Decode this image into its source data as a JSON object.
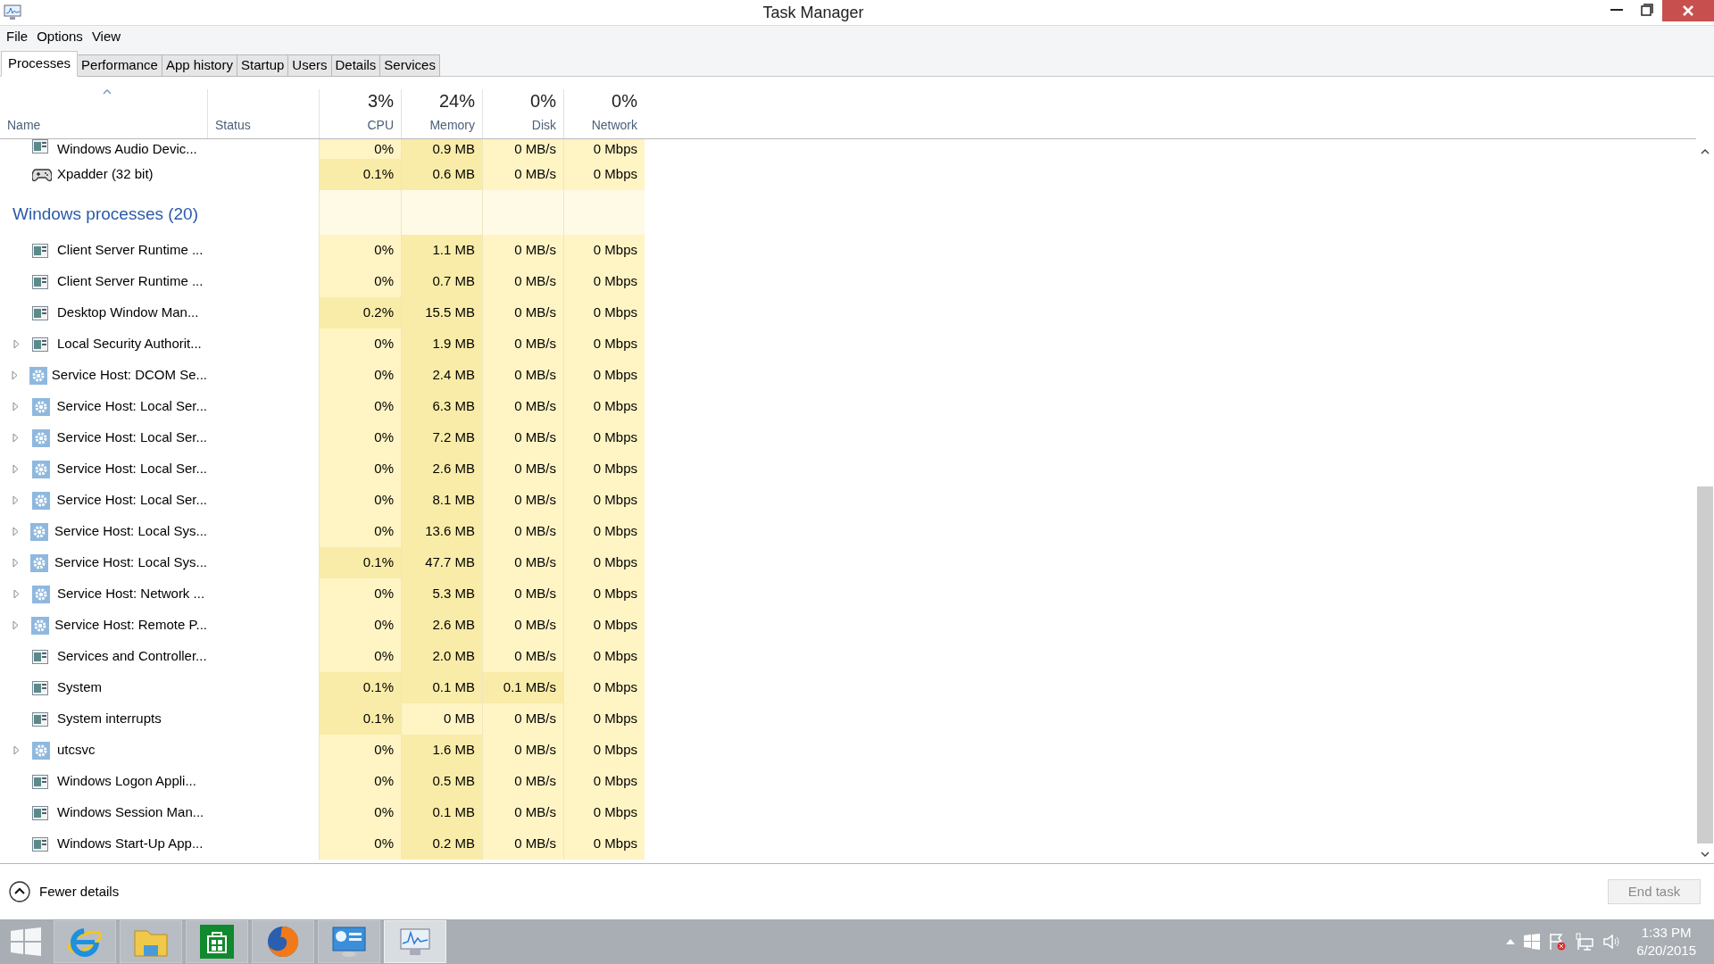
{
  "window": {
    "title": "Task Manager"
  },
  "menu": [
    "File",
    "Options",
    "View"
  ],
  "tabs": [
    {
      "label": "Processes",
      "selected": true
    },
    {
      "label": "Performance",
      "selected": false
    },
    {
      "label": "App history",
      "selected": false
    },
    {
      "label": "Startup",
      "selected": false
    },
    {
      "label": "Users",
      "selected": false
    },
    {
      "label": "Details",
      "selected": false
    },
    {
      "label": "Services",
      "selected": false
    }
  ],
  "table": {
    "columns": [
      {
        "label": "Name",
        "sorted": true
      },
      {
        "label": "Status",
        "sorted": false
      },
      {
        "label": "CPU",
        "total": "3%",
        "sorted": false
      },
      {
        "label": "Memory",
        "total": "24%",
        "sorted": false
      },
      {
        "label": "Disk",
        "total": "0%",
        "sorted": false
      },
      {
        "label": "Network",
        "total": "0%",
        "sorted": false
      }
    ],
    "rows": [
      {
        "kind": "app",
        "expandable": false,
        "name": "Windows Audio Devic...",
        "cells": [
          {
            "text": "0%",
            "color": "#fff4c4"
          },
          {
            "text": "0.9 MB",
            "color": "#f9eca8"
          },
          {
            "text": "0 MB/s",
            "color": "#fff4c4"
          },
          {
            "text": "0 Mbps",
            "color": "#fff4c4"
          }
        ]
      },
      {
        "kind": "game",
        "expandable": false,
        "name": "Xpadder (32 bit)",
        "cells": [
          {
            "text": "0.1%",
            "color": "#f9eca8"
          },
          {
            "text": "0.6 MB",
            "color": "#f9eca8"
          },
          {
            "text": "0 MB/s",
            "color": "#fff4c4"
          },
          {
            "text": "0 Mbps",
            "color": "#fff4c4"
          }
        ]
      },
      {
        "kind": "group",
        "name": "Windows processes (20)"
      },
      {
        "kind": "app",
        "expandable": false,
        "name": "Client Server Runtime ...",
        "cells": [
          {
            "text": "0%",
            "color": "#fff4c4"
          },
          {
            "text": "1.1 MB",
            "color": "#f9eca8"
          },
          {
            "text": "0 MB/s",
            "color": "#fff4c4"
          },
          {
            "text": "0 Mbps",
            "color": "#fff4c4"
          }
        ]
      },
      {
        "kind": "app",
        "expandable": false,
        "name": "Client Server Runtime ...",
        "cells": [
          {
            "text": "0%",
            "color": "#fff4c4"
          },
          {
            "text": "0.7 MB",
            "color": "#f9eca8"
          },
          {
            "text": "0 MB/s",
            "color": "#fff4c4"
          },
          {
            "text": "0 Mbps",
            "color": "#fff4c4"
          }
        ]
      },
      {
        "kind": "app",
        "expandable": false,
        "name": "Desktop Window Man...",
        "cells": [
          {
            "text": "0.2%",
            "color": "#f9eca8"
          },
          {
            "text": "15.5 MB",
            "color": "#f9eca8"
          },
          {
            "text": "0 MB/s",
            "color": "#fff4c4"
          },
          {
            "text": "0 Mbps",
            "color": "#fff4c4"
          }
        ]
      },
      {
        "kind": "app",
        "expandable": true,
        "name": "Local Security Authorit...",
        "cells": [
          {
            "text": "0%",
            "color": "#fff4c4"
          },
          {
            "text": "1.9 MB",
            "color": "#f9eca8"
          },
          {
            "text": "0 MB/s",
            "color": "#fff4c4"
          },
          {
            "text": "0 Mbps",
            "color": "#fff4c4"
          }
        ]
      },
      {
        "kind": "service",
        "expandable": true,
        "name": "Service Host: DCOM Se...",
        "cells": [
          {
            "text": "0%",
            "color": "#fff4c4"
          },
          {
            "text": "2.4 MB",
            "color": "#f9eca8"
          },
          {
            "text": "0 MB/s",
            "color": "#fff4c4"
          },
          {
            "text": "0 Mbps",
            "color": "#fff4c4"
          }
        ]
      },
      {
        "kind": "service",
        "expandable": true,
        "name": "Service Host: Local Ser...",
        "cells": [
          {
            "text": "0%",
            "color": "#fff4c4"
          },
          {
            "text": "6.3 MB",
            "color": "#f9eca8"
          },
          {
            "text": "0 MB/s",
            "color": "#fff4c4"
          },
          {
            "text": "0 Mbps",
            "color": "#fff4c4"
          }
        ]
      },
      {
        "kind": "service",
        "expandable": true,
        "name": "Service Host: Local Ser...",
        "cells": [
          {
            "text": "0%",
            "color": "#fff4c4"
          },
          {
            "text": "7.2 MB",
            "color": "#f9eca8"
          },
          {
            "text": "0 MB/s",
            "color": "#fff4c4"
          },
          {
            "text": "0 Mbps",
            "color": "#fff4c4"
          }
        ]
      },
      {
        "kind": "service",
        "expandable": true,
        "name": "Service Host: Local Ser...",
        "cells": [
          {
            "text": "0%",
            "color": "#fff4c4"
          },
          {
            "text": "2.6 MB",
            "color": "#f9eca8"
          },
          {
            "text": "0 MB/s",
            "color": "#fff4c4"
          },
          {
            "text": "0 Mbps",
            "color": "#fff4c4"
          }
        ]
      },
      {
        "kind": "service",
        "expandable": true,
        "name": "Service Host: Local Ser...",
        "cells": [
          {
            "text": "0%",
            "color": "#fff4c4"
          },
          {
            "text": "8.1 MB",
            "color": "#f9eca8"
          },
          {
            "text": "0 MB/s",
            "color": "#fff4c4"
          },
          {
            "text": "0 Mbps",
            "color": "#fff4c4"
          }
        ]
      },
      {
        "kind": "service",
        "expandable": true,
        "name": "Service Host: Local Sys...",
        "cells": [
          {
            "text": "0%",
            "color": "#fff4c4"
          },
          {
            "text": "13.6 MB",
            "color": "#f9eca8"
          },
          {
            "text": "0 MB/s",
            "color": "#fff4c4"
          },
          {
            "text": "0 Mbps",
            "color": "#fff4c4"
          }
        ]
      },
      {
        "kind": "service",
        "expandable": true,
        "name": "Service Host: Local Sys...",
        "cells": [
          {
            "text": "0.1%",
            "color": "#f9eca8"
          },
          {
            "text": "47.7 MB",
            "color": "#f9eca8"
          },
          {
            "text": "0 MB/s",
            "color": "#fff4c4"
          },
          {
            "text": "0 Mbps",
            "color": "#fff4c4"
          }
        ]
      },
      {
        "kind": "service",
        "expandable": true,
        "name": "Service Host: Network ...",
        "cells": [
          {
            "text": "0%",
            "color": "#fff4c4"
          },
          {
            "text": "5.3 MB",
            "color": "#f9eca8"
          },
          {
            "text": "0 MB/s",
            "color": "#fff4c4"
          },
          {
            "text": "0 Mbps",
            "color": "#fff4c4"
          }
        ]
      },
      {
        "kind": "service",
        "expandable": true,
        "name": "Service Host: Remote P...",
        "cells": [
          {
            "text": "0%",
            "color": "#fff4c4"
          },
          {
            "text": "2.6 MB",
            "color": "#f9eca8"
          },
          {
            "text": "0 MB/s",
            "color": "#fff4c4"
          },
          {
            "text": "0 Mbps",
            "color": "#fff4c4"
          }
        ]
      },
      {
        "kind": "app",
        "expandable": false,
        "name": "Services and Controller...",
        "cells": [
          {
            "text": "0%",
            "color": "#fff4c4"
          },
          {
            "text": "2.0 MB",
            "color": "#f9eca8"
          },
          {
            "text": "0 MB/s",
            "color": "#fff4c4"
          },
          {
            "text": "0 Mbps",
            "color": "#fff4c4"
          }
        ]
      },
      {
        "kind": "app",
        "expandable": false,
        "name": "System",
        "cells": [
          {
            "text": "0.1%",
            "color": "#f9eca8"
          },
          {
            "text": "0.1 MB",
            "color": "#f9eca8"
          },
          {
            "text": "0.1 MB/s",
            "color": "#f9eca8"
          },
          {
            "text": "0 Mbps",
            "color": "#fff4c4"
          }
        ]
      },
      {
        "kind": "app",
        "expandable": false,
        "name": "System interrupts",
        "cells": [
          {
            "text": "0.1%",
            "color": "#f9eca8"
          },
          {
            "text": "0 MB",
            "color": "#fff4c4"
          },
          {
            "text": "0 MB/s",
            "color": "#fff4c4"
          },
          {
            "text": "0 Mbps",
            "color": "#fff4c4"
          }
        ]
      },
      {
        "kind": "service",
        "expandable": true,
        "name": "utcsvc",
        "cells": [
          {
            "text": "0%",
            "color": "#fff4c4"
          },
          {
            "text": "1.6 MB",
            "color": "#f9eca8"
          },
          {
            "text": "0 MB/s",
            "color": "#fff4c4"
          },
          {
            "text": "0 Mbps",
            "color": "#fff4c4"
          }
        ]
      },
      {
        "kind": "app",
        "expandable": false,
        "name": "Windows Logon Appli...",
        "cells": [
          {
            "text": "0%",
            "color": "#fff4c4"
          },
          {
            "text": "0.5 MB",
            "color": "#f9eca8"
          },
          {
            "text": "0 MB/s",
            "color": "#fff4c4"
          },
          {
            "text": "0 Mbps",
            "color": "#fff4c4"
          }
        ]
      },
      {
        "kind": "app",
        "expandable": false,
        "name": "Windows Session Man...",
        "cells": [
          {
            "text": "0%",
            "color": "#fff4c4"
          },
          {
            "text": "0.1 MB",
            "color": "#f9eca8"
          },
          {
            "text": "0 MB/s",
            "color": "#fff4c4"
          },
          {
            "text": "0 Mbps",
            "color": "#fff4c4"
          }
        ]
      },
      {
        "kind": "app",
        "expandable": false,
        "name": "Windows Start-Up App...",
        "cells": [
          {
            "text": "0%",
            "color": "#fff4c4"
          },
          {
            "text": "0.2 MB",
            "color": "#f9eca8"
          },
          {
            "text": "0 MB/s",
            "color": "#fff4c4"
          },
          {
            "text": "0 Mbps",
            "color": "#fff4c4"
          }
        ]
      }
    ]
  },
  "footer": {
    "details_link": "Fewer details",
    "end_task": {
      "label": "End task",
      "disabled": true
    }
  },
  "taskbar": {
    "apps": [
      {
        "kind": "ie",
        "active": false
      },
      {
        "kind": "folder",
        "active": false
      },
      {
        "kind": "store",
        "active": false
      },
      {
        "kind": "firefox",
        "active": false
      },
      {
        "kind": "control",
        "active": false
      },
      {
        "kind": "taskmgr",
        "active": true
      }
    ],
    "clock": {
      "time": "1:33 PM",
      "date": "6/20/2015"
    }
  }
}
